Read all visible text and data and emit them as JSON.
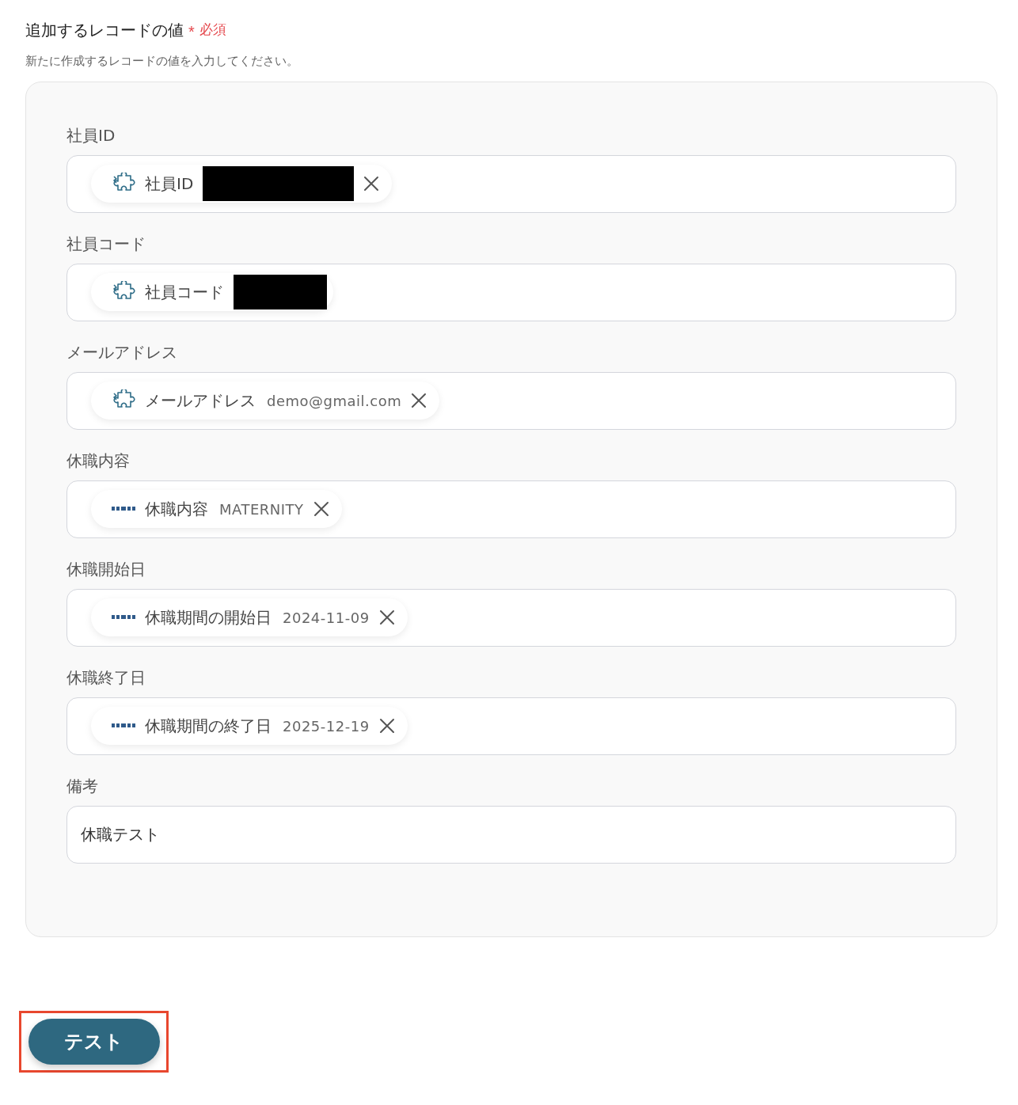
{
  "section": {
    "title": "追加するレコードの値",
    "required_mark": "*",
    "required_label": "必須",
    "description": "新たに作成するレコードの値を入力してください。"
  },
  "fields": [
    {
      "label": "社員ID",
      "kind": "chip",
      "chip": {
        "kind": "variable",
        "label": "社員ID",
        "redacted": true,
        "removable": true
      }
    },
    {
      "label": "社員コード",
      "kind": "chip",
      "chip": {
        "kind": "variable",
        "label": "社員コード",
        "redacted": true,
        "removable": false
      }
    },
    {
      "label": "メールアドレス",
      "kind": "chip",
      "chip": {
        "kind": "variable",
        "label": "メールアドレス",
        "value": "demo@gmail.com",
        "redacted": false,
        "removable": true
      }
    },
    {
      "label": "休職内容",
      "kind": "chip",
      "chip": {
        "kind": "app",
        "label": "休職内容",
        "value": "MATERNITY",
        "redacted": false,
        "removable": true
      }
    },
    {
      "label": "休職開始日",
      "kind": "chip",
      "chip": {
        "kind": "app",
        "label": "休職期間の開始日",
        "value": "2024-11-09",
        "redacted": false,
        "removable": true
      }
    },
    {
      "label": "休職終了日",
      "kind": "chip",
      "chip": {
        "kind": "app",
        "label": "休職期間の終了日",
        "value": "2025-12-19",
        "redacted": false,
        "removable": true
      }
    },
    {
      "label": "備考",
      "kind": "text",
      "value": "休職テスト"
    }
  ],
  "test_button": {
    "label": "テスト",
    "highlighted": true
  }
}
